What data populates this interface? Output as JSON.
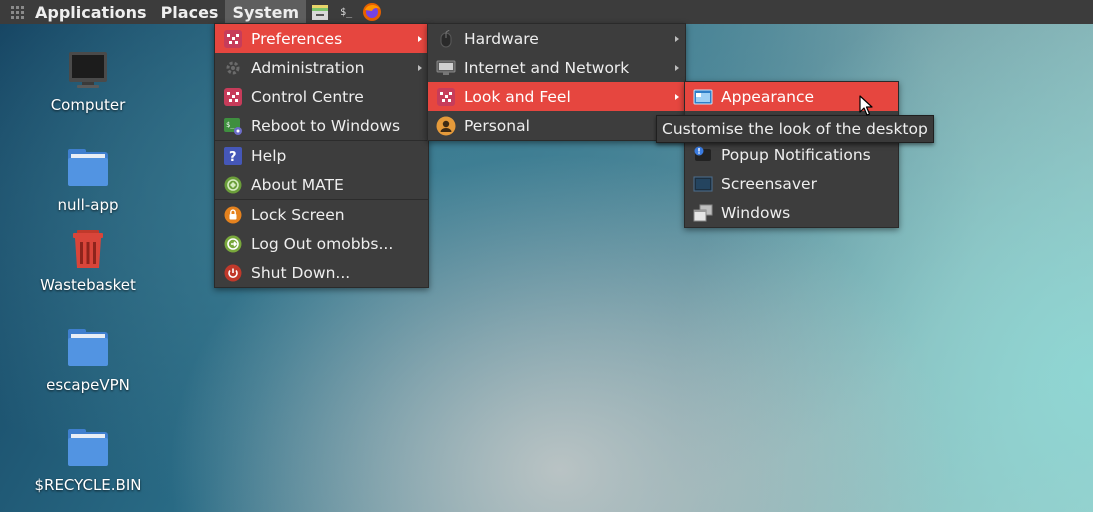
{
  "panel": {
    "menus": [
      {
        "label": "Applications"
      },
      {
        "label": "Places"
      },
      {
        "label": "System"
      }
    ],
    "launchers": [
      "file-manager-icon",
      "terminal-icon",
      "firefox-icon"
    ],
    "terminal_glyph": "$_"
  },
  "desktop": {
    "icons": [
      {
        "label": "Computer",
        "icon": "computer-icon"
      },
      {
        "label": "null-app",
        "icon": "folder-icon"
      },
      {
        "label": "Wastebasket",
        "icon": "trash-icon"
      },
      {
        "label": "escapeVPN",
        "icon": "folder-icon"
      },
      {
        "label": "$RECYCLE.BIN",
        "icon": "folder-icon"
      }
    ]
  },
  "system_menu": {
    "items": [
      {
        "label": "Preferences"
      },
      {
        "label": "Administration"
      },
      {
        "label": "Control Centre"
      },
      {
        "label": "Reboot to Windows"
      },
      {
        "label": "Help"
      },
      {
        "label": "About MATE"
      },
      {
        "label": "Lock Screen"
      },
      {
        "label": "Log Out omobbs..."
      },
      {
        "label": "Shut Down..."
      }
    ]
  },
  "preferences_menu": {
    "items": [
      {
        "label": "Hardware"
      },
      {
        "label": "Internet and Network"
      },
      {
        "label": "Look and Feel"
      },
      {
        "label": "Personal"
      }
    ]
  },
  "look_feel_menu": {
    "items": [
      {
        "label": "Appearance"
      },
      {
        "label": "Popup Notifications"
      },
      {
        "label": "Screensaver"
      },
      {
        "label": "Windows"
      }
    ]
  },
  "tooltip": {
    "text": "Customise the look of the desktop"
  },
  "colors": {
    "panel": "#3c3c3c",
    "menu": "#3d3d3d",
    "highlight": "#e6463f"
  }
}
